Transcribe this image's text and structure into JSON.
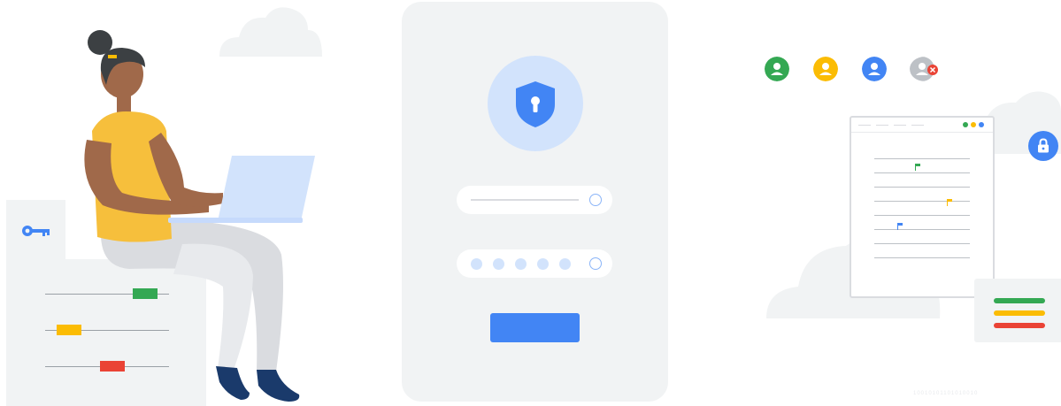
{
  "colors": {
    "blue": "#4285f4",
    "light_blue": "#d2e3fc",
    "green": "#34a853",
    "yellow": "#fbbc04",
    "red": "#ea4335",
    "grey_panel": "#f1f3f4",
    "skin": "#a0694a",
    "top": "#f6bf3c",
    "pants": "#dadce0",
    "laptop": "#d2e3fc"
  },
  "illustration": {
    "left_person": {
      "icon": "woman-with-laptop-illustration"
    },
    "key_card": {
      "icon": "key-icon"
    },
    "sliders": [
      {
        "color": "green"
      },
      {
        "color": "yellow"
      },
      {
        "color": "red"
      }
    ],
    "login_panel": {
      "shield_icon": "shield-keyhole-icon",
      "password_dots": 5
    },
    "avatars": [
      {
        "color": "green",
        "state": "active"
      },
      {
        "color": "yellow",
        "state": "active"
      },
      {
        "color": "blue",
        "state": "active"
      },
      {
        "color": "grey",
        "state": "removed"
      }
    ],
    "document_flags": [
      "green",
      "yellow",
      "blue"
    ],
    "status_bars": [
      "green",
      "yellow",
      "red"
    ],
    "watermark": "10010101101010010"
  }
}
